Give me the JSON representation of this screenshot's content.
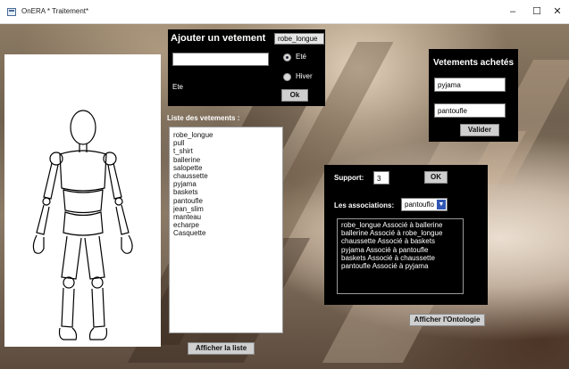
{
  "window": {
    "title": "OnERA * Traitement*",
    "minimize_glyph": "–",
    "maximize_glyph": "☐",
    "close_glyph": "✕"
  },
  "add_panel": {
    "heading": "Ajouter un vetement",
    "type_value": "robe_longue",
    "name_value": "",
    "season_label": "Ete",
    "radio_summer": "Eté",
    "radio_winter": "Hiver",
    "ok_label": "Ok"
  },
  "clothes_list": {
    "label": "Liste des vetements :",
    "items": [
      "robe_longue",
      "pull",
      "t_shirt",
      "ballerine",
      "salopette",
      "chaussette",
      "pyjama",
      "baskets",
      "pantoufle",
      "jean_slim",
      "manteau",
      "echarpe",
      "Casquette"
    ]
  },
  "show_list_button": "Afficher la liste",
  "purchased_panel": {
    "heading": "Vetements achetés",
    "item1": "pyjama",
    "item2": "pantoufle",
    "validate_label": "Valider"
  },
  "assoc_panel": {
    "support_label": "Support:",
    "support_value": "3",
    "ok_label": "OK",
    "assoc_label": "Les associations:",
    "assoc_selected": "pantouflo",
    "assoc_dropdown_icon": "chevron-down-icon",
    "results": [
      "robe_longue Associé à ballerine",
      "ballerine Associé à robe_longue",
      "chaussette Associé à baskets",
      "pyjama Associé à pantoufle",
      "baskets Associé à chaussette",
      "pantoufle Associé à pyjama"
    ]
  },
  "show_ontology_button": "Afficher l'Ontologie",
  "colors": {
    "panel_background": "#000000",
    "dropdown_arrow": "#2f57b3"
  }
}
